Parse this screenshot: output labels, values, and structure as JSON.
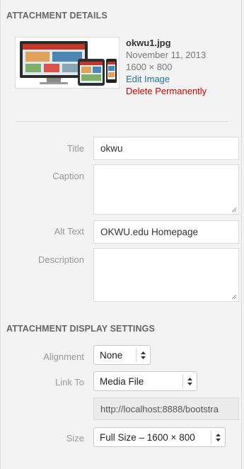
{
  "details": {
    "heading": "Attachment Details",
    "thumbnail_icon": "responsive-devices-preview-icon",
    "filename": "okwu1.jpg",
    "date": "November 11, 2013",
    "dimensions": "1600 × 800",
    "edit_label": "Edit Image",
    "delete_label": "Delete Permanently"
  },
  "fields": {
    "title_label": "Title",
    "title_value": "okwu",
    "caption_label": "Caption",
    "caption_value": "",
    "alt_label": "Alt Text",
    "alt_value": "OKWU.edu Homepage",
    "description_label": "Description",
    "description_value": ""
  },
  "display": {
    "heading": "Attachment Display Settings",
    "alignment_label": "Alignment",
    "alignment_value": "None",
    "link_label": "Link To",
    "link_value": "Media File",
    "url_value": "http://localhost:8888/bootstra",
    "size_label": "Size",
    "size_value": "Full Size – 1600 × 800"
  },
  "colors": {
    "link": "#21759b",
    "delete": "#cc0000",
    "panel_bg": "#f3f3f3"
  }
}
